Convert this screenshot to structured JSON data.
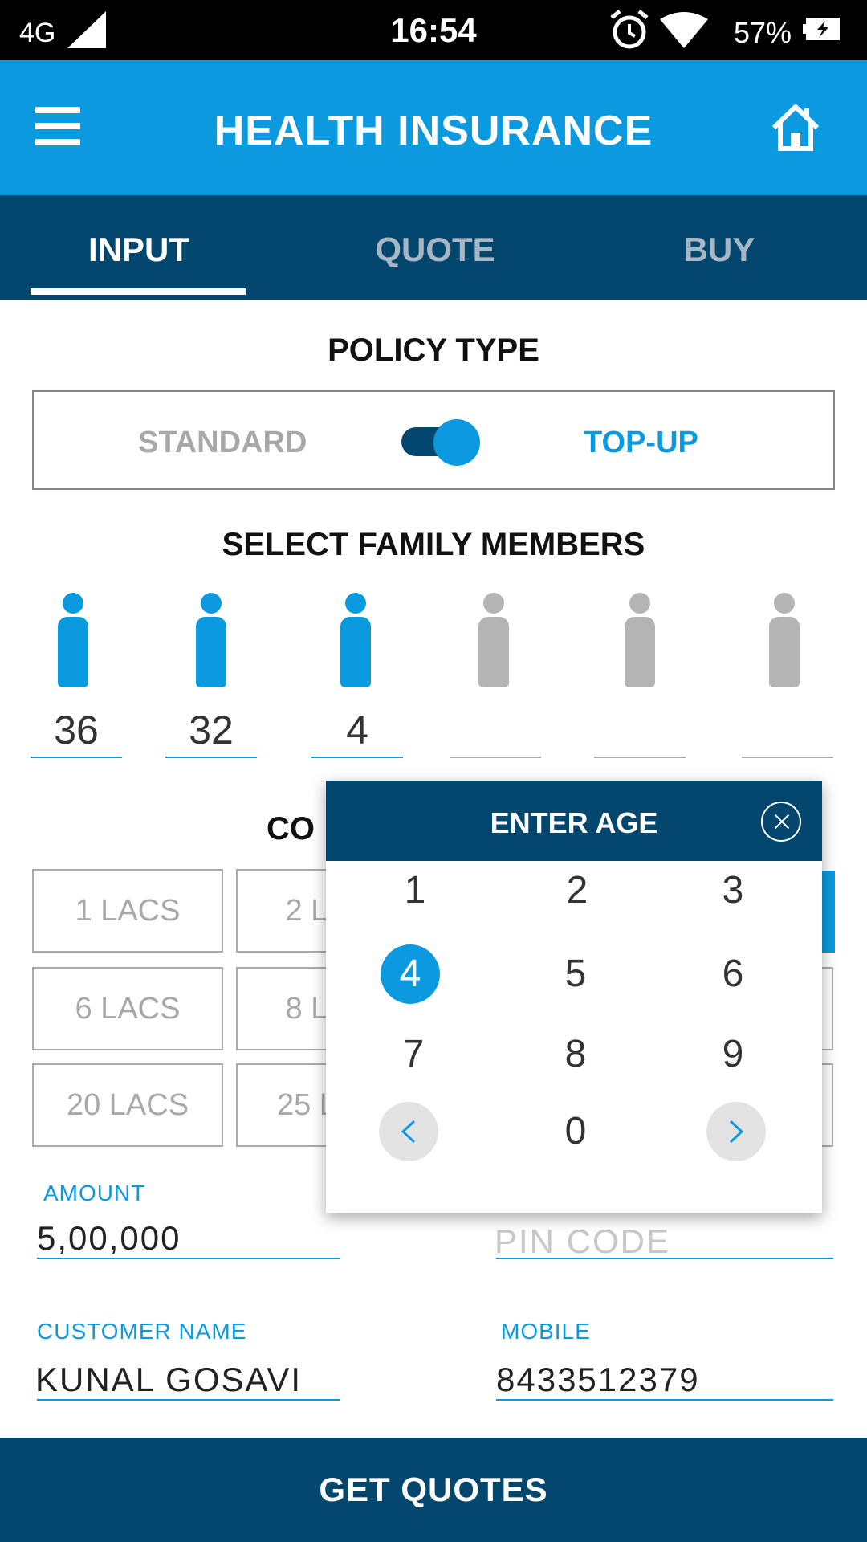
{
  "status_bar": {
    "network": "4G",
    "time": "16:54",
    "battery": "57%"
  },
  "app_bar": {
    "title": "HEALTH INSURANCE"
  },
  "tabs": [
    {
      "label": "INPUT",
      "active": true
    },
    {
      "label": "QUOTE",
      "active": false
    },
    {
      "label": "BUY",
      "active": false
    }
  ],
  "policy": {
    "title": "POLICY TYPE",
    "left_option": "STANDARD",
    "right_option": "TOP-UP",
    "selected": "TOP-UP"
  },
  "family": {
    "title": "SELECT FAMILY MEMBERS",
    "members": [
      {
        "age": "36",
        "active": true
      },
      {
        "age": "32",
        "active": true
      },
      {
        "age": "4",
        "active": true
      },
      {
        "age": "",
        "active": false
      },
      {
        "age": "",
        "active": false
      },
      {
        "age": "",
        "active": false
      }
    ]
  },
  "cover": {
    "title_partial": "CO",
    "options": [
      "1 LACS",
      "2 LACS",
      "6 LACS",
      "8 LACS",
      "20 LACS",
      "25 LACS"
    ]
  },
  "fields": {
    "amount_label": "AMOUNT",
    "amount_value": "5,00,000",
    "pincode_placeholder": "PIN CODE",
    "customer_label": "CUSTOMER NAME",
    "customer_value": "KUNAL GOSAVI",
    "mobile_label": "MOBILE",
    "mobile_value": "8433512379"
  },
  "dialog": {
    "title": "ENTER AGE",
    "keys": [
      "1",
      "2",
      "3",
      "4",
      "5",
      "6",
      "7",
      "8",
      "9",
      "0"
    ],
    "selected_key": "4"
  },
  "footer": {
    "button_label": "GET QUOTES"
  },
  "colors": {
    "primary": "#0b9ae0",
    "dark": "#03466e",
    "inactive": "#a8a8a8"
  }
}
